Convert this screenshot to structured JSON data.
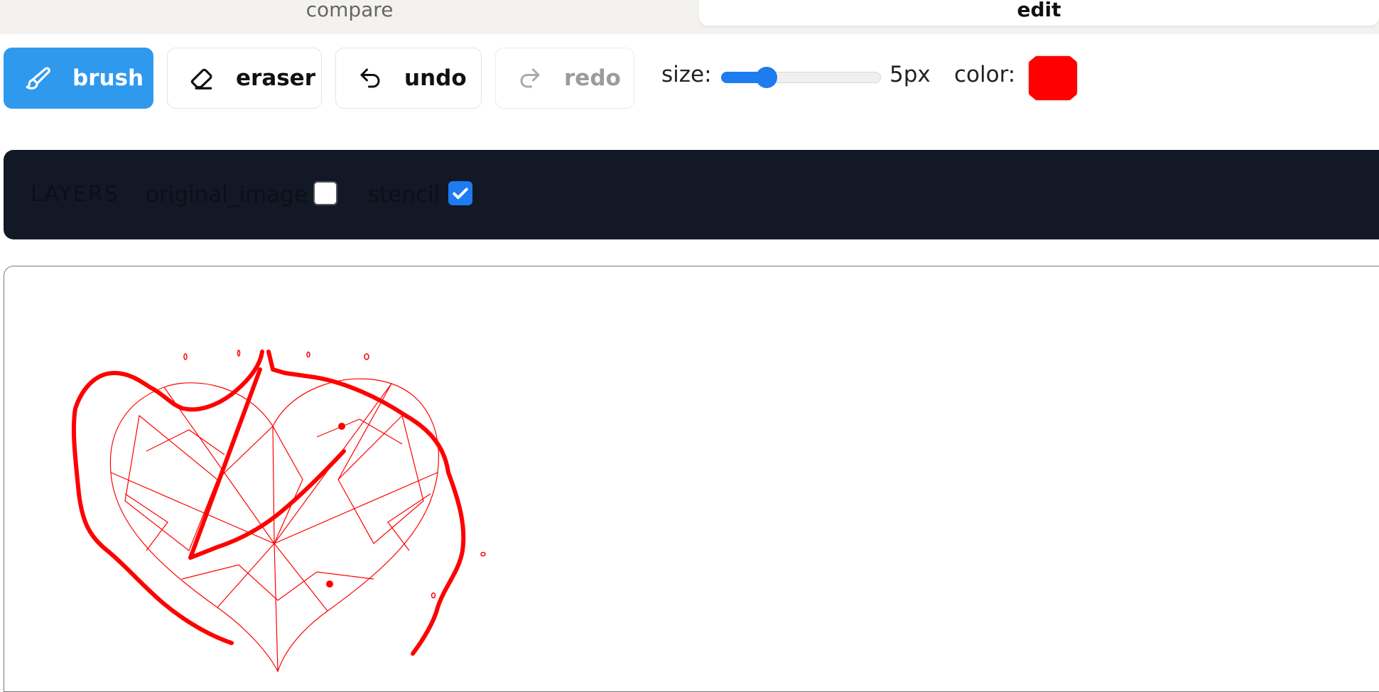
{
  "tabs": {
    "compare": "compare",
    "edit": "edit"
  },
  "toolbar": {
    "brush": "brush",
    "eraser": "eraser",
    "undo": "undo",
    "redo": "redo",
    "size_label": "size:",
    "size_value": "5px",
    "size_fraction": 0.25,
    "color_label": "color:",
    "color_value": "#ff0000"
  },
  "layers": {
    "title": "LAYERS",
    "items": [
      {
        "label": "original_image",
        "checked": false
      },
      {
        "label": "stencil",
        "checked": true
      }
    ]
  },
  "colors": {
    "accent": "#2f99ee",
    "slider": "#1c7cf0",
    "layers_bg": "#121826",
    "drawing": "#ff0000"
  }
}
